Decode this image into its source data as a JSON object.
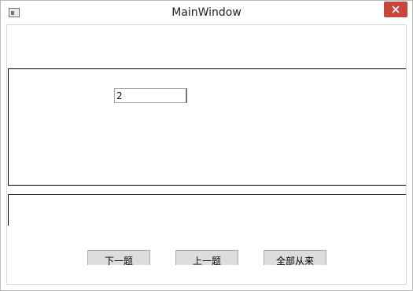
{
  "window": {
    "title": "MainWindow"
  },
  "icons": {
    "app": "window-app-icon",
    "close": "close-icon"
  },
  "colors": {
    "close_button": "#c7453b"
  },
  "input": {
    "value": "2"
  },
  "buttons": {
    "next_label": "下一题",
    "prev_label": "上一题",
    "restart_label": "全部从来"
  }
}
